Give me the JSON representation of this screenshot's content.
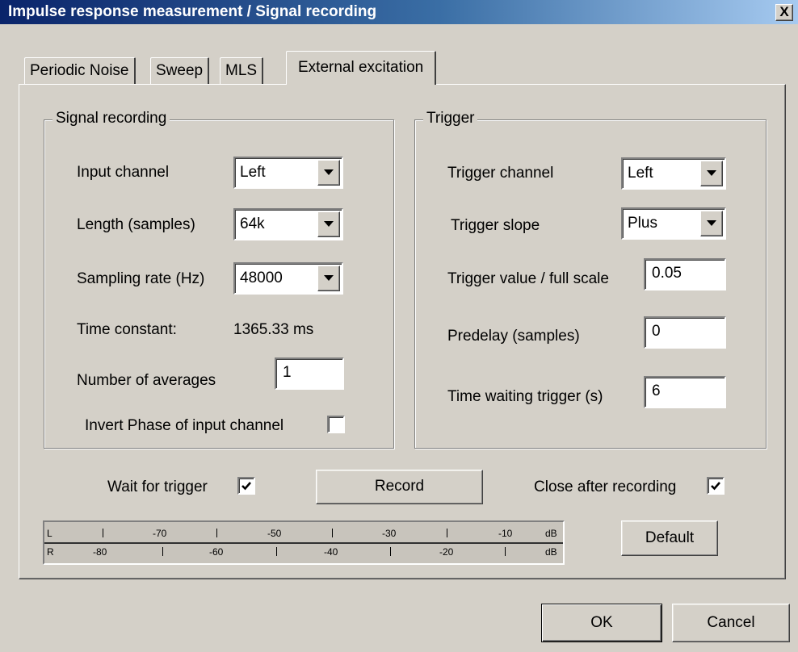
{
  "window": {
    "title": "Impulse response measurement / Signal recording",
    "close_glyph": "X"
  },
  "tabs": [
    {
      "label": "Periodic Noise",
      "active": false
    },
    {
      "label": "Sweep",
      "active": false
    },
    {
      "label": "MLS",
      "active": false
    },
    {
      "label": "External excitation",
      "active": true
    }
  ],
  "signal_recording": {
    "legend": "Signal recording",
    "input_channel": {
      "label": "Input channel",
      "value": "Left"
    },
    "length": {
      "label": "Length (samples)",
      "value": "64k"
    },
    "sampling_rate": {
      "label": "Sampling rate (Hz)",
      "value": "48000"
    },
    "time_constant": {
      "label": "Time constant:",
      "value": "1365.33 ms"
    },
    "averages": {
      "label": "Number of averages",
      "value": "1"
    },
    "invert_phase": {
      "label": "Invert Phase of input channel",
      "checked": false
    }
  },
  "trigger": {
    "legend": "Trigger",
    "channel": {
      "label": "Trigger channel",
      "value": "Left"
    },
    "slope": {
      "label": "Trigger slope",
      "value": "Plus"
    },
    "value": {
      "label": "Trigger value / full scale",
      "value": "0.05"
    },
    "predelay": {
      "label": "Predelay (samples)",
      "value": "0"
    },
    "wait_time": {
      "label": "Time waiting trigger (s)",
      "value": "6"
    }
  },
  "options": {
    "wait_for_trigger": {
      "label": "Wait for trigger",
      "checked": true
    },
    "close_after": {
      "label": "Close after recording",
      "checked": true
    }
  },
  "buttons": {
    "record": "Record",
    "default": "Default",
    "ok": "OK",
    "cancel": "Cancel"
  },
  "meter": {
    "left_channel": "L",
    "right_channel": "R",
    "unit": "dB",
    "l_marks": [
      "-70",
      "-50",
      "-30",
      "-10"
    ],
    "r_marks": [
      "-80",
      "-60",
      "-40",
      "-20"
    ]
  }
}
